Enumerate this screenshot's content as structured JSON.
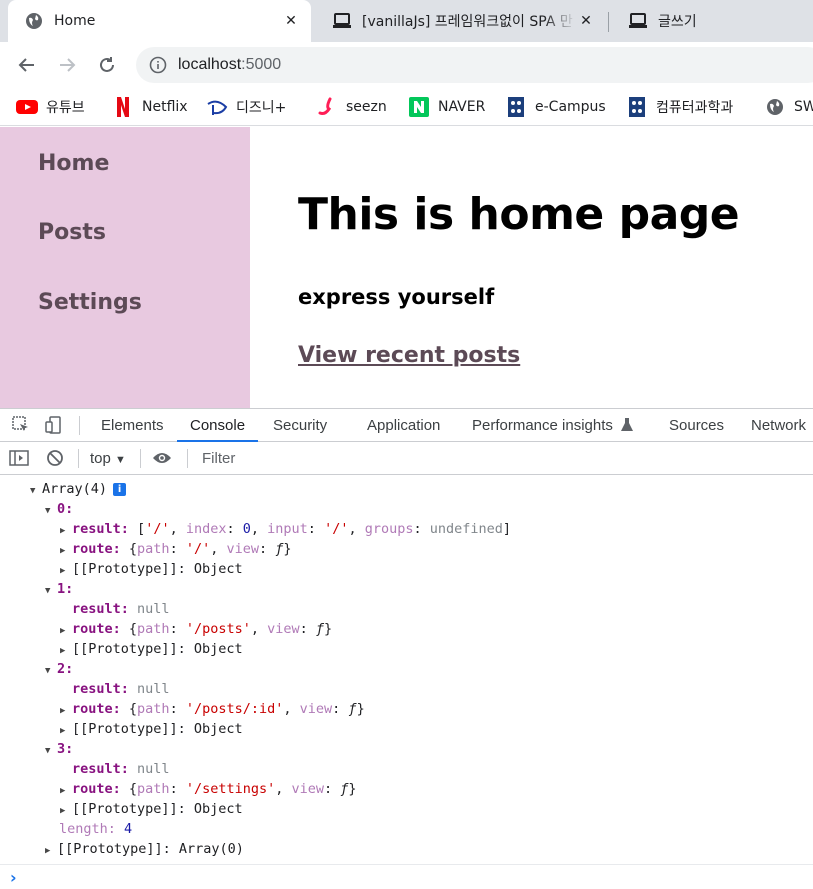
{
  "browser": {
    "tabs": [
      {
        "title": "Home",
        "icon": "globe-icon",
        "active": true
      },
      {
        "title": "[vanillaJs] 프레임워크없이 SPA 만",
        "icon": "laptop-icon",
        "active": false
      },
      {
        "title": "글쓰기",
        "icon": "laptop-icon",
        "active": false
      }
    ],
    "close_glyph": "✕",
    "url_host": "localhost",
    "url_port": ":5000",
    "bookmarks": [
      {
        "label": "유튜브",
        "icon": "youtube-icon"
      },
      {
        "label": "Netflix",
        "icon": "netflix-icon"
      },
      {
        "label": "디즈니+",
        "icon": "disney-plus-icon"
      },
      {
        "label": "seezn",
        "icon": "seezn-icon"
      },
      {
        "label": "NAVER",
        "icon": "naver-icon"
      },
      {
        "label": "e-Campus",
        "icon": "university-icon"
      },
      {
        "label": "컴퓨터과학과",
        "icon": "university-icon"
      },
      {
        "label": "SW",
        "icon": "globe-icon"
      }
    ]
  },
  "page": {
    "nav": [
      {
        "label": "Home"
      },
      {
        "label": "Posts"
      },
      {
        "label": "Settings"
      }
    ],
    "heading": "This is home page",
    "tagline": "express yourself",
    "cta": "View recent posts",
    "colors": {
      "sidebar": "#e8c9e0",
      "nav_text": "#5c4a56"
    }
  },
  "devtools": {
    "tabs": [
      "Elements",
      "Console",
      "Security",
      "Application",
      "Performance insights",
      "Sources",
      "Network"
    ],
    "active_tab": "Console",
    "context": "top",
    "filter_placeholder": "Filter",
    "console": {
      "root_label": "Array(4)",
      "info_badge": "i",
      "entries": [
        {
          "index": "0:",
          "result_key": "result:",
          "result_value": "['/', index: 0, input: '/', groups: undefined]",
          "result_expandable": true,
          "route_key": "route:",
          "route_path": "'/'",
          "proto": "[[Prototype]]: Object"
        },
        {
          "index": "1:",
          "result_key": "result:",
          "result_value": "null",
          "result_expandable": false,
          "route_key": "route:",
          "route_path": "'/posts'",
          "proto": "[[Prototype]]: Object"
        },
        {
          "index": "2:",
          "result_key": "result:",
          "result_value": "null",
          "result_expandable": false,
          "route_key": "route:",
          "route_path": "'/posts/:id'",
          "proto": "[[Prototype]]: Object"
        },
        {
          "index": "3:",
          "result_key": "result:",
          "result_value": "null",
          "result_expandable": false,
          "route_key": "route:",
          "route_path": "'/settings'",
          "proto": "[[Prototype]]: Object"
        }
      ],
      "length_key": "length:",
      "length_value": "4",
      "root_proto": "[[Prototype]]: Array(0)",
      "prompt": "›"
    }
  }
}
